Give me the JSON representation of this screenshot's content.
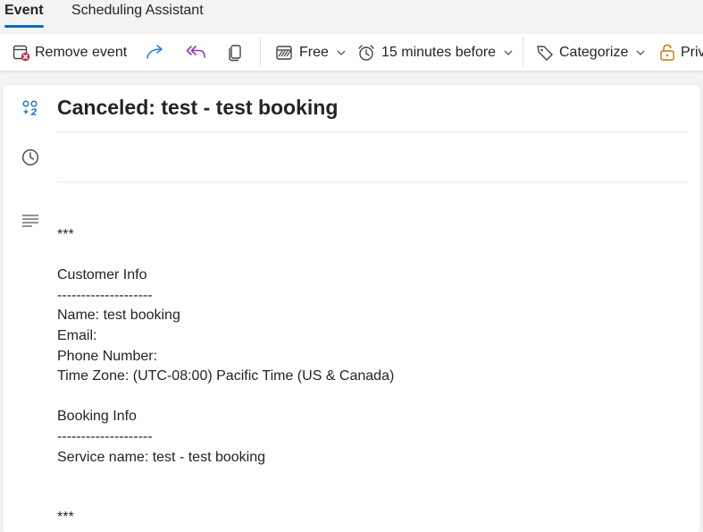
{
  "tabs": {
    "event": "Event",
    "scheduling": "Scheduling Assistant"
  },
  "toolbar": {
    "remove_event": "Remove event",
    "show_as": "Free",
    "reminder": "15 minutes before",
    "categorize": "Categorize",
    "private": "Private"
  },
  "event": {
    "title": "Canceled: test - test booking"
  },
  "body_lines": [
    "***",
    "",
    "Customer Info",
    "--------------------",
    "Name: test booking",
    "Email:",
    "Phone Number:",
    "Time Zone: (UTC-08:00) Pacific Time (US & Canada)",
    "",
    "Booking Info",
    "--------------------",
    "Service name: test - test booking",
    "",
    "",
    "***"
  ],
  "colors": {
    "accent": "#0f6cbd",
    "remove_icon": "#c4314b",
    "forward_icon": "#2b7cd3",
    "reply_all_icon": "#8a3ab9"
  }
}
